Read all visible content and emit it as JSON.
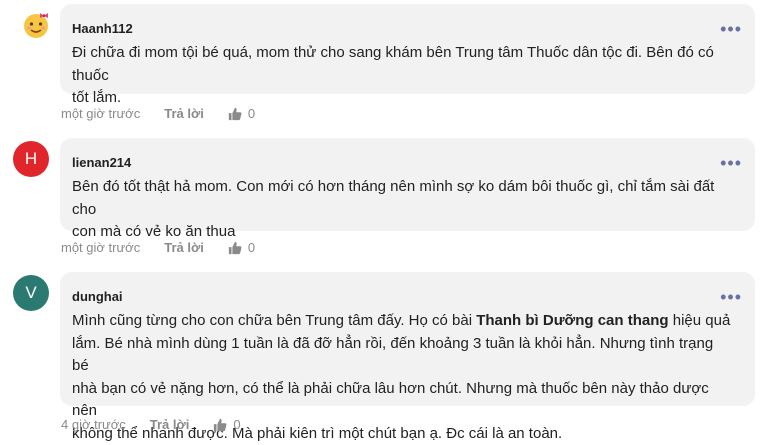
{
  "comments": [
    {
      "username": "Haanh112",
      "avatar_kind": "emoji",
      "avatar_icon": "girl-emoji-icon",
      "avatar_color": "#f6c544",
      "text_lines": [
        "Đi chữa đi mom tội bé quá, mom thử cho sang khám bên Trung tâm Thuốc dân tộc đi. Bên đó có thuốc",
        "tốt lắm."
      ],
      "time": "một giờ trước",
      "reply_label": "Trả lời",
      "likes": "0"
    },
    {
      "username": "lienan214",
      "avatar_kind": "letter",
      "avatar_letter": "H",
      "avatar_color": "#e0252b",
      "text_lines": [
        "Bên đó tốt thật hả mom. Con mới có hơn tháng nên mình sợ ko dám bôi thuốc gì, chỉ tắm sài đất cho",
        "con mà có vẻ ko ăn thua"
      ],
      "time": "một giờ trước",
      "reply_label": "Trả lời",
      "likes": "0"
    },
    {
      "username": "dunghai",
      "avatar_kind": "letter",
      "avatar_letter": "V",
      "avatar_color": "#2b7a72",
      "text_before": "Mình cũng từng cho con chữa bên Trung tâm đấy. Họ có bài ",
      "text_bold": "Thanh bì Dưỡng can thang",
      "text_after": " hiệu quả",
      "text_lines": [
        "lắm. Bé nhà mình dùng 1 tuần là đã đỡ hẳn rồi, đến khoảng 3 tuần là khỏi hẳn. Nhưng tình trạng bé",
        "nhà bạn có vẻ nặng hơn, có thể là phải chữa lâu hơn chút. Nhưng mà thuốc bên này thảo dược nên",
        "không thể nhanh được. Mà phải kiên trì một chút bạn ạ. Đc cái là an toàn."
      ],
      "time": "4 giờ trước",
      "reply_label": "Trả lời",
      "likes": "0"
    }
  ],
  "colors": {
    "bubble": "#f2f2f2",
    "more_dots": "#6a6fa8",
    "meta": "#8a8a8a"
  }
}
